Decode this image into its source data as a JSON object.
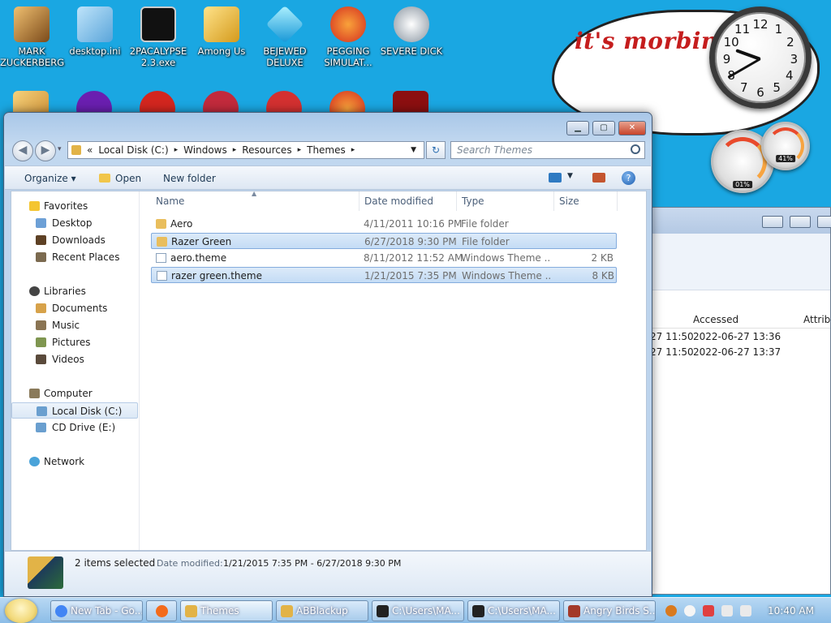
{
  "desktop": {
    "icons": [
      {
        "label": "MARK ZUCKERBERG",
        "color": "#c98b3a"
      },
      {
        "label": "desktop.ini",
        "color": "#6fb8e6"
      },
      {
        "label": "2PACALYPSE 2.3.exe",
        "color": "#111111"
      },
      {
        "label": "Among Us",
        "color": "#f2c230"
      },
      {
        "label": "BEJEWED DELUXE",
        "color": "#39c6f0"
      },
      {
        "label": "PEGGING SIMULAT...",
        "color": "#e8422a"
      },
      {
        "label": "SEVERE DICK",
        "color": "#cfd5db"
      }
    ],
    "second_row_icons": [
      "folder-icon",
      "yahoo-icon",
      "angry-birds-icon",
      "angry-birds-icon",
      "pin-icon",
      "pegging-icon",
      "flash-icon"
    ]
  },
  "gadgets": {
    "note_text": "it's morbin",
    "clock_numbers": [
      "12",
      "1",
      "2",
      "3",
      "4",
      "5",
      "6",
      "7",
      "8",
      "9",
      "10",
      "11"
    ],
    "cpu_percent": "01%",
    "ram_percent": "41%"
  },
  "background_window": {
    "column_accessed": "Accessed",
    "column_attrib": "Attribu",
    "rows": [
      {
        "modified": "27 11:50",
        "accessed": "2022-06-27 13:36"
      },
      {
        "modified": "27 11:50",
        "accessed": "2022-06-27 13:37"
      }
    ]
  },
  "explorer": {
    "address": {
      "crumbs": [
        "«",
        "Local Disk (C:)",
        "▸",
        "Windows",
        "▸",
        "Resources",
        "▸",
        "Themes",
        "▸"
      ]
    },
    "search_placeholder": "Search Themes",
    "toolbar": {
      "organize": "Organize ▾",
      "open": "Open",
      "new_folder": "New folder"
    },
    "nav": {
      "favorites": "Favorites",
      "desktop": "Desktop",
      "downloads": "Downloads",
      "recent": "Recent Places",
      "libraries": "Libraries",
      "documents": "Documents",
      "music": "Music",
      "pictures": "Pictures",
      "videos": "Videos",
      "computer": "Computer",
      "local_disk": "Local Disk (C:)",
      "cd_drive": "CD Drive (E:)",
      "network": "Network"
    },
    "columns": {
      "name": "Name",
      "date": "Date modified",
      "type": "Type",
      "size": "Size"
    },
    "files": [
      {
        "name": "Aero",
        "date": "4/11/2011 10:16 PM",
        "type": "File folder",
        "size": "",
        "selected": false,
        "kind": "folder"
      },
      {
        "name": "Razer Green",
        "date": "6/27/2018 9:30 PM",
        "type": "File folder",
        "size": "",
        "selected": true,
        "kind": "folder"
      },
      {
        "name": "aero.theme",
        "date": "8/11/2012 11:52 AM",
        "type": "Windows Theme ...",
        "size": "2 KB",
        "selected": false,
        "kind": "file"
      },
      {
        "name": "razer green.theme",
        "date": "1/21/2015 7:35 PM",
        "type": "Windows Theme ...",
        "size": "8 KB",
        "selected": true,
        "kind": "file"
      }
    ],
    "details": {
      "count": "2 items selected",
      "label": "Date modified:",
      "range": "1/21/2015 7:35 PM - 6/27/2018 9:30 PM"
    }
  },
  "taskbar": {
    "tasks": [
      {
        "label": "New Tab - Go...",
        "color": "#4285f4"
      },
      {
        "label": "",
        "color": "#f36b1c"
      },
      {
        "label": "Themes",
        "color": "#e2b347"
      },
      {
        "label": "ABBlackup",
        "color": "#e2b347"
      },
      {
        "label": "C:\\Users\\MA...",
        "color": "#222222"
      },
      {
        "label": "C:\\Users\\MA...",
        "color": "#222222"
      },
      {
        "label": "Angry Birds S...",
        "color": "#a33a2a"
      }
    ],
    "time": "10:40 AM"
  }
}
